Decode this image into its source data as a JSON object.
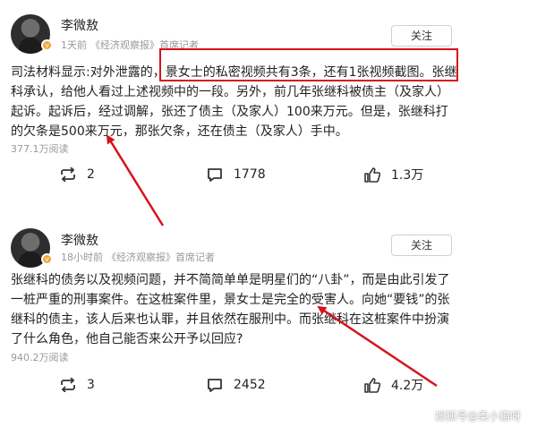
{
  "posts": [
    {
      "author": "李微敖",
      "time": "1天前",
      "source": "《经济观察报》首席记者",
      "follow_label": "关注",
      "body": "司法材料显示:对外泄露的，景女士的私密视频共有3条，还有1张视频截图。张继科承认，给他人看过上述视频中的一段。另外，前几年张继科被债主（及家人）起诉。起诉后，经过调解，张还了债主（及家人）100来万元。但是，张继科打的欠条是500来万元，那张欠条，还在债主（及家人）手中。",
      "reads": "377.1万阅读",
      "repost_count": "2",
      "comment_count": "1778",
      "like_count": "1.3万"
    },
    {
      "author": "李微敖",
      "time": "18小时前",
      "source": "《经济观察报》首席记者",
      "follow_label": "关注",
      "body": "张继科的债务以及视频问题，并不简简单单是明星们的“八卦”，而是由此引发了一桩严重的刑事案件。在这桩案件里，景女士是完全的受害人。向她“要钱”的张继科的债主，该人后来也认罪，并且依然在服刑中。而张继科在这桩案件中扮演了什么角色，他自己能否来公开予以回应?",
      "reads": "940.2万阅读",
      "repost_count": "3",
      "comment_count": "2452",
      "like_count": "4.2万"
    }
  ],
  "watermark": "搜狐号@柔小猫呀",
  "colors": {
    "highlight": "#d8121b",
    "muted": "#999999",
    "badge": "#f2a33a"
  },
  "icons": [
    "repost-icon",
    "comment-icon",
    "like-icon",
    "verified-badge-icon"
  ]
}
